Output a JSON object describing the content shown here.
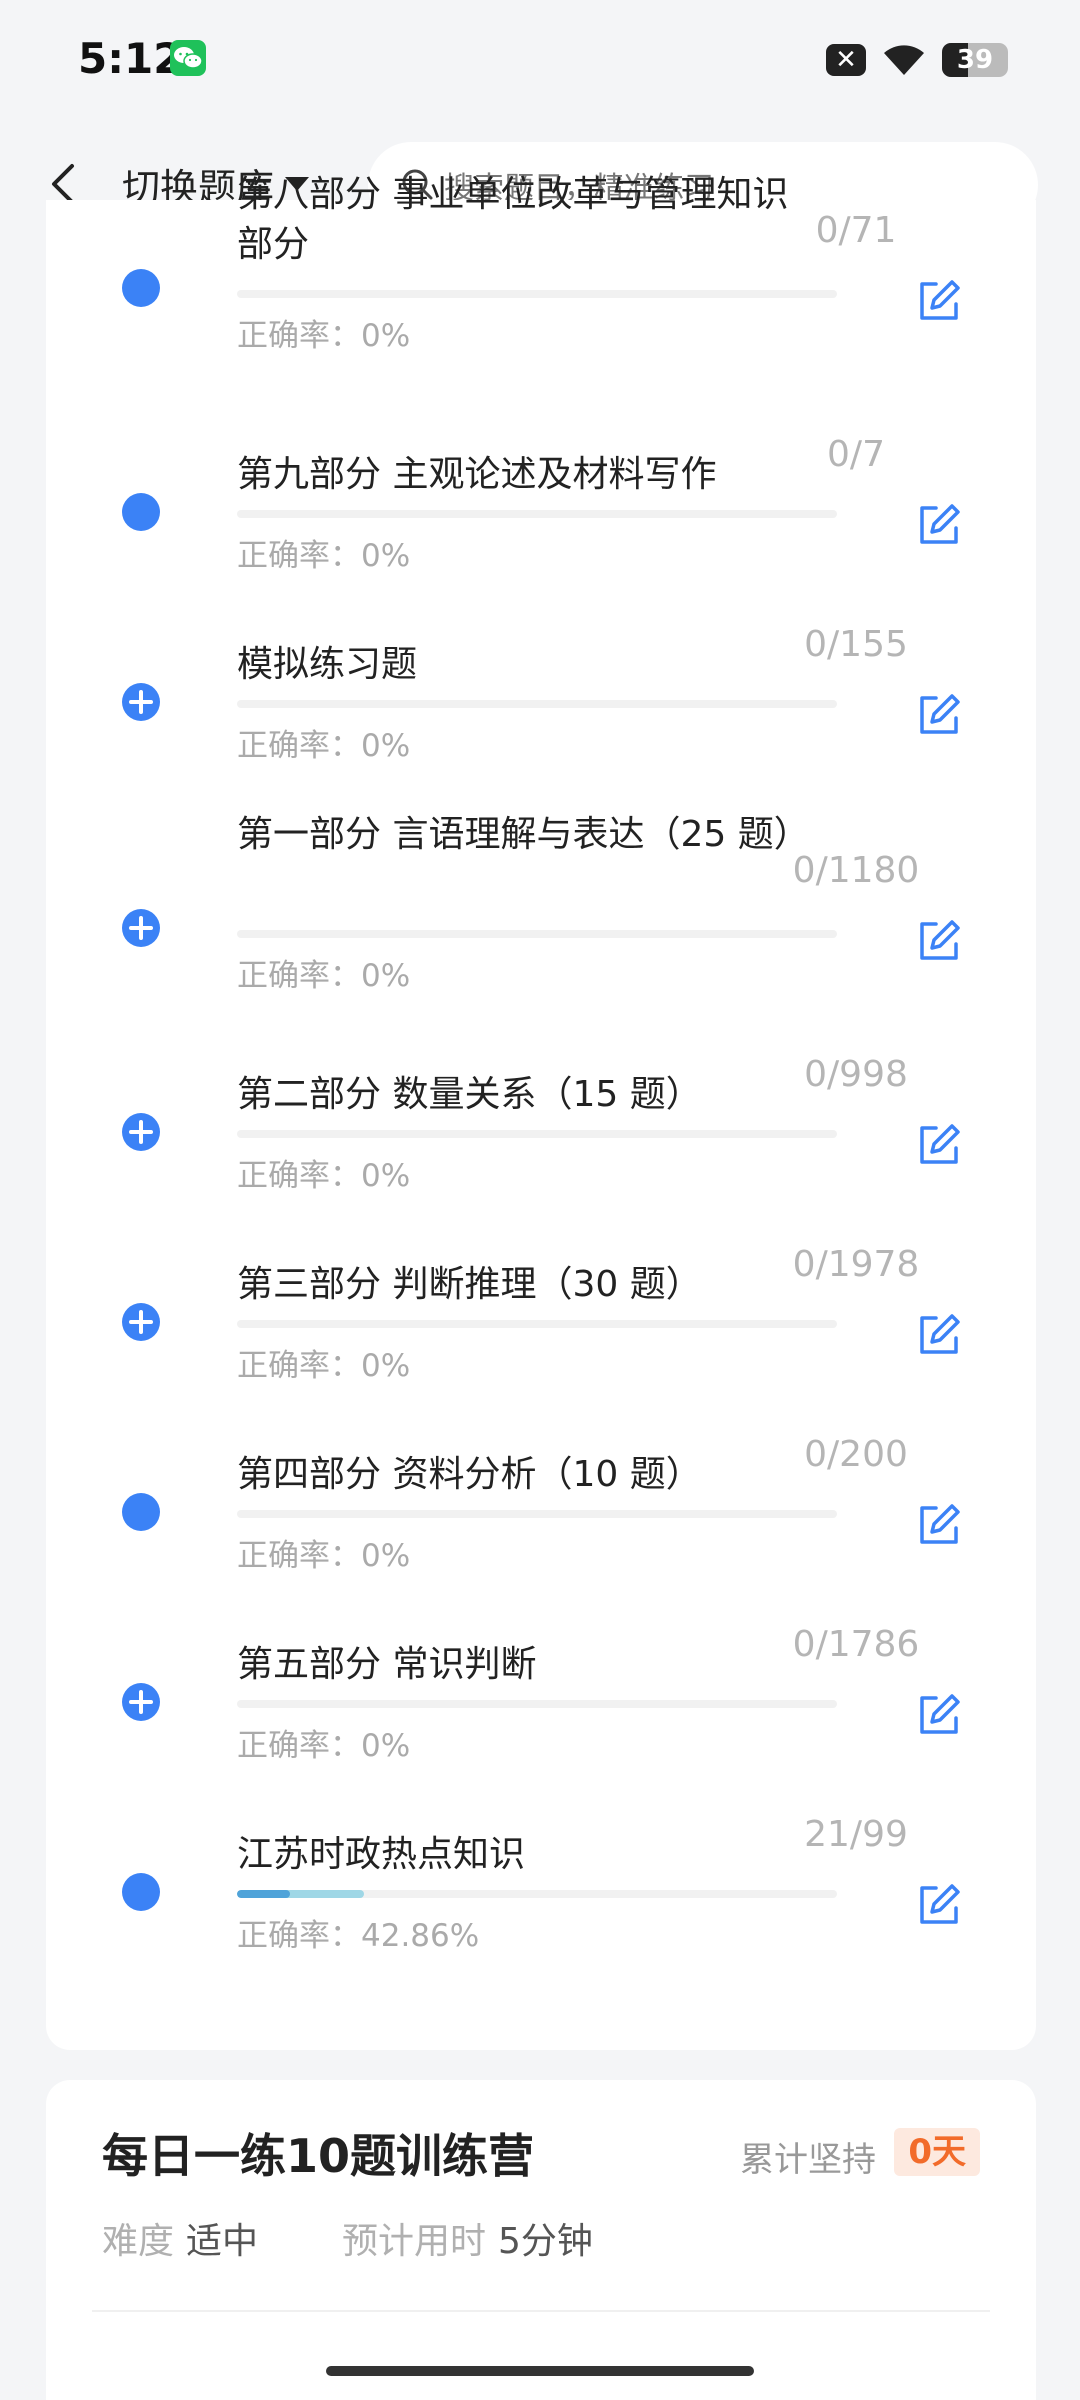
{
  "status_bar": {
    "time": "5:12",
    "battery": "39",
    "close_badge": "✕"
  },
  "header": {
    "bank_switch_label": "切换题库",
    "search_placeholder": "搜索题目，精准练习"
  },
  "items": [
    {
      "title": "第八部分 事业单位改革与管理知识部分",
      "accuracy": "正确率：0%",
      "count": "0/71",
      "icon": "dot-icon",
      "progress": 0
    },
    {
      "title": "第九部分 主观论述及材料写作",
      "accuracy": "正确率：0%",
      "count": "0/7",
      "icon": "dot-icon",
      "progress": 0
    },
    {
      "title": "模拟练习题",
      "accuracy": "正确率：0%",
      "count": "0/155",
      "icon": "plus-circle-icon",
      "progress": 0
    },
    {
      "title": "第一部分 言语理解与表达（25 题）",
      "accuracy": "正确率：0%",
      "count": "0/1180",
      "icon": "plus-circle-icon",
      "progress": 0
    },
    {
      "title": "第二部分 数量关系（15 题）",
      "accuracy": "正确率：0%",
      "count": "0/998",
      "icon": "plus-circle-icon",
      "progress": 0
    },
    {
      "title": "第三部分 判断推理（30 题）",
      "accuracy": "正确率：0%",
      "count": "0/1978",
      "icon": "plus-circle-icon",
      "progress": 0
    },
    {
      "title": "第四部分 资料分析（10 题）",
      "accuracy": "正确率：0%",
      "count": "0/200",
      "icon": "dot-icon",
      "progress": 0
    },
    {
      "title": "第五部分 常识判断",
      "accuracy": "正确率：0%",
      "count": "0/1786",
      "icon": "plus-circle-icon",
      "progress": 0
    },
    {
      "title": "江苏时政热点知识",
      "accuracy": "正确率：42.86%",
      "count": "21/99",
      "icon": "dot-icon",
      "progress": 0.2121
    }
  ],
  "camp": {
    "title": "每日一练10题训练营",
    "streak_label": "累计坚持",
    "streak_value": "0天",
    "difficulty_label": "难度",
    "difficulty_value": "适中",
    "time_label": "预计用时",
    "time_value": "5分钟"
  },
  "colors": {
    "accent": "#3b82f6",
    "streak": "#f26b2a",
    "progress": "#4fa3d9"
  }
}
